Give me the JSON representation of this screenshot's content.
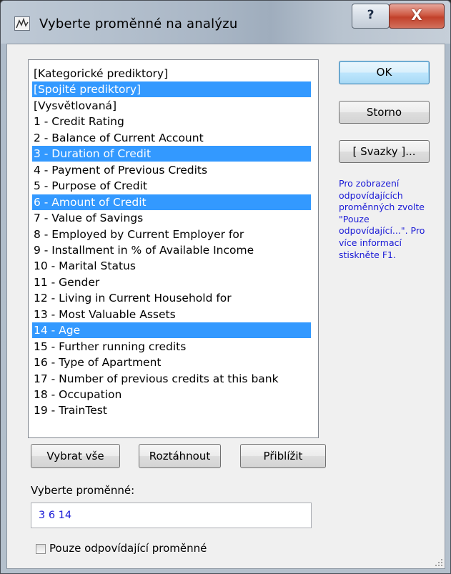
{
  "window": {
    "title": "Vyberte proměnné na analýzu",
    "help_label": "?",
    "close_label": "X"
  },
  "variable_list": {
    "items": [
      {
        "label": "[Kategorické prediktory]",
        "selected": false
      },
      {
        "label": "[Spojité prediktory]",
        "selected": true
      },
      {
        "label": "[Vysvětlovaná]",
        "selected": false
      },
      {
        "label": "1 - Credit Rating",
        "selected": false
      },
      {
        "label": "2 - Balance of Current Account",
        "selected": false
      },
      {
        "label": "3 - Duration of Credit",
        "selected": true
      },
      {
        "label": "4 - Payment of Previous Credits",
        "selected": false
      },
      {
        "label": "5 - Purpose of Credit",
        "selected": false
      },
      {
        "label": "6 - Amount of Credit",
        "selected": true
      },
      {
        "label": "7 - Value of Savings",
        "selected": false
      },
      {
        "label": "8 - Employed by Current Employer for",
        "selected": false
      },
      {
        "label": "9 - Installment in % of Available Income",
        "selected": false
      },
      {
        "label": "10 - Marital Status",
        "selected": false
      },
      {
        "label": "11 - Gender",
        "selected": false
      },
      {
        "label": "12 - Living in Current Household for",
        "selected": false
      },
      {
        "label": "13 - Most Valuable Assets",
        "selected": false
      },
      {
        "label": "14 - Age",
        "selected": true
      },
      {
        "label": "15 - Further running credits",
        "selected": false
      },
      {
        "label": "16 - Type of Apartment",
        "selected": false
      },
      {
        "label": "17 - Number of previous credits at this bank",
        "selected": false
      },
      {
        "label": "18 - Occupation",
        "selected": false
      },
      {
        "label": "19 - TrainTest",
        "selected": false
      }
    ]
  },
  "buttons": {
    "ok": "OK",
    "cancel": "Storno",
    "bundles": "[ Svazky ]...",
    "select_all": "Vybrat vše",
    "expand": "Roztáhnout",
    "zoom": "Přiblížit"
  },
  "hint_text": "Pro zobrazení odpovídajících proměnných zvolte \"Pouze odpovídající...\". Pro více informací stiskněte F1.",
  "selection": {
    "label": "Vyberte proměnné:",
    "value": "3 6 14"
  },
  "filter_checkbox": {
    "label": "Pouze odpovídající proměnné",
    "checked": false
  },
  "colors": {
    "selection_bg": "#3399ff",
    "hint_text": "#1a1ad6",
    "close_button": "#c2412b"
  }
}
